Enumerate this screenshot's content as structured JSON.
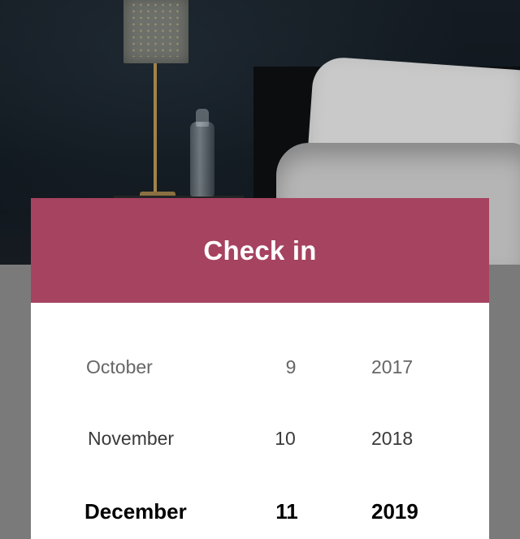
{
  "dialog": {
    "title": "Check in",
    "accent_color": "#a64360"
  },
  "picker": {
    "rows": [
      {
        "month": "October",
        "day": "9",
        "year": "2017"
      },
      {
        "month": "November",
        "day": "10",
        "year": "2018"
      },
      {
        "month": "December",
        "day": "11",
        "year": "2019"
      }
    ],
    "selected_index": 2
  }
}
